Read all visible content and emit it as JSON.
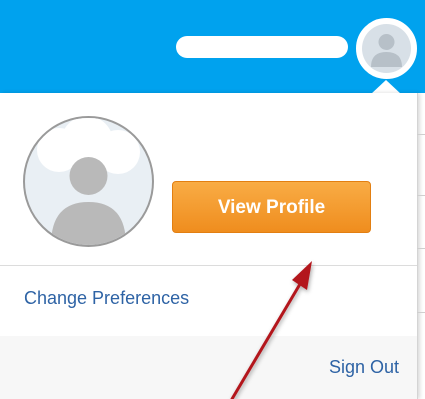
{
  "header": {
    "background_color": "#00a2ee",
    "user_name_redacted": true,
    "avatar_icon": "user-avatar-icon"
  },
  "profile_menu": {
    "avatar_icon": "user-silhouette-icon",
    "view_profile_label": "View Profile",
    "view_profile_color": "#f39a2b",
    "change_preferences_label": "Change Preferences",
    "sign_out_label": "Sign Out",
    "link_color": "#2e63a5"
  },
  "annotation": {
    "arrow_color": "#b3161d",
    "points_to": "view-profile-button"
  }
}
